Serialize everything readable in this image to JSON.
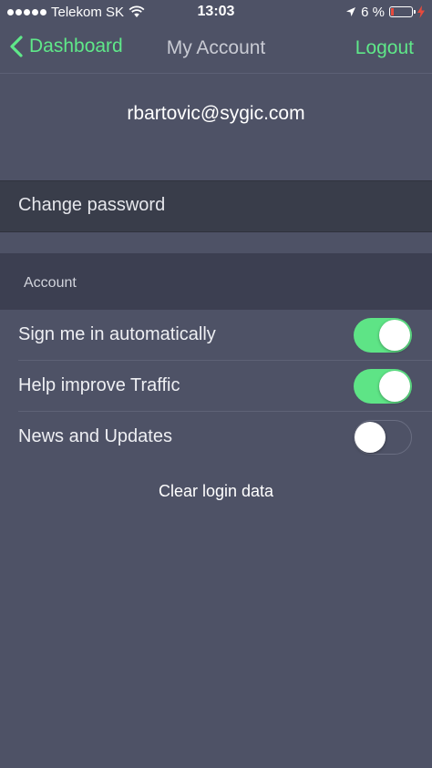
{
  "status_bar": {
    "carrier": "Telekom SK",
    "time": "13:03",
    "battery": "6 %",
    "battery_level": 0.06,
    "battery_color": "#e84a3c"
  },
  "nav": {
    "back_label": "Dashboard",
    "title": "My Account",
    "logout_label": "Logout"
  },
  "account_email": "rbartovic@sygic.com",
  "change_password_label": "Change password",
  "section": {
    "header": "Account",
    "settings": [
      {
        "label": "Sign me in automatically",
        "enabled": true
      },
      {
        "label": "Help improve Traffic",
        "enabled": true
      },
      {
        "label": "News and Updates",
        "enabled": false
      }
    ]
  },
  "clear_login_label": "Clear login data",
  "colors": {
    "accent": "#5fe889",
    "background": "#4e5266",
    "toggle_on": "#5ee486"
  },
  "icons": {
    "back": "chevron-left-icon",
    "wifi": "wifi-icon",
    "location": "location-arrow-icon",
    "battery": "battery-icon",
    "charging": "charging-bolt-icon"
  }
}
